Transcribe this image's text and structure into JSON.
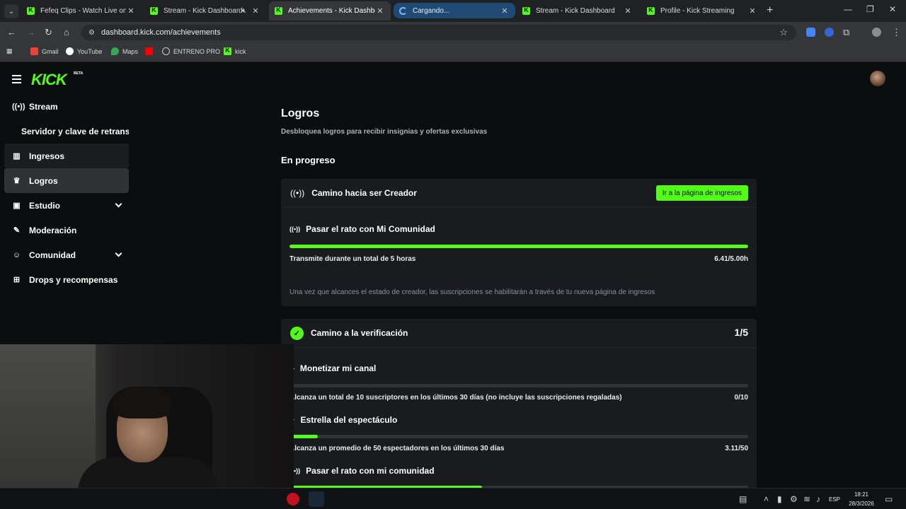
{
  "browser": {
    "tabs": [
      {
        "title": "Fefeq Clips - Watch Live on Kick",
        "state": "normal"
      },
      {
        "title": "Stream - Kick Dashboard",
        "state": "muted"
      },
      {
        "title": "Achievements - Kick Dashboard",
        "state": "active"
      },
      {
        "title": "Cargando...",
        "state": "loading"
      },
      {
        "title": "Stream - Kick Dashboard",
        "state": "normal"
      },
      {
        "title": "Profile - Kick Streaming",
        "state": "normal"
      }
    ],
    "url": "dashboard.kick.com/achievements",
    "bookmarks": [
      {
        "label": "Gmail",
        "icon": "gmail-icon",
        "color": "#ea4335"
      },
      {
        "label": "YouTube",
        "icon": "youtube-icon",
        "color": "#ffffff"
      },
      {
        "label": "Maps",
        "icon": "maps-icon",
        "color": "#34a853"
      },
      {
        "label": "",
        "icon": "youtube-red-icon",
        "color": "#ff0000"
      },
      {
        "label": "ENTRENO PRO",
        "icon": "globe-icon",
        "color": "#c8cbcf"
      },
      {
        "label": "kick",
        "icon": "kick-icon",
        "color": "#53fc18"
      }
    ]
  },
  "kick": {
    "logo": "KICK",
    "logo_badge": "BETA",
    "sidebar": [
      {
        "label": "Stream",
        "icon": "broadcast-icon",
        "state": "normal"
      },
      {
        "label": "Servidor y clave de retransmisión",
        "icon": "",
        "state": "sub"
      },
      {
        "label": "Ingresos",
        "icon": "chart-icon",
        "state": "hover"
      },
      {
        "label": "Logros",
        "icon": "trophy-icon",
        "state": "active"
      },
      {
        "label": "Estudio",
        "icon": "studio-icon",
        "state": "expandable"
      },
      {
        "label": "Moderación",
        "icon": "wrench-icon",
        "state": "normal"
      },
      {
        "label": "Comunidad",
        "icon": "community-icon",
        "state": "expandable"
      },
      {
        "label": "Drops y recompensas",
        "icon": "gift-icon",
        "state": "normal"
      }
    ],
    "page_title": "Logros",
    "page_subtitle": "Desbloquea logros para recibir insignias y ofertas exclusivas",
    "section_title": "En progreso",
    "creator_card": {
      "title": "Camino hacia ser Creador",
      "button": "Ir a la página de ingresos",
      "task": {
        "title": "Pasar el rato con Mi Comunidad",
        "desc": "Transmite durante un total de 5 horas",
        "value": "6.41/5.00h",
        "progress": 1.0
      },
      "note": "Una vez que alcances el estado de creador, las suscripciones se habilitarán a través de tu nueva página de ingresos"
    },
    "verify_card": {
      "title": "Camino a la verificación",
      "count": "1/5",
      "tasks": [
        {
          "title": "Monetizar mi canal",
          "desc": "Alcanza un total de 10 suscriptores en los últimos 30 días (no incluye las suscripciones regaladas)",
          "value": "0/10",
          "progress": 0.0
        },
        {
          "title": "Estrella del espectáculo",
          "desc": "Alcanza un promedio de 50 espectadores en los últimos 30 días",
          "value": "3.11/50",
          "progress": 0.0622
        },
        {
          "title": "Pasar el rato con mi comunidad",
          "desc": "",
          "value": "",
          "progress": 0.42
        }
      ]
    }
  },
  "taskbar": {
    "language": "ESP",
    "time": "18:21",
    "date": "28/3/2026"
  },
  "colors": {
    "kick_green": "#53fc18",
    "page_bg": "#0b0e0f",
    "card_bg": "#191b1f"
  }
}
